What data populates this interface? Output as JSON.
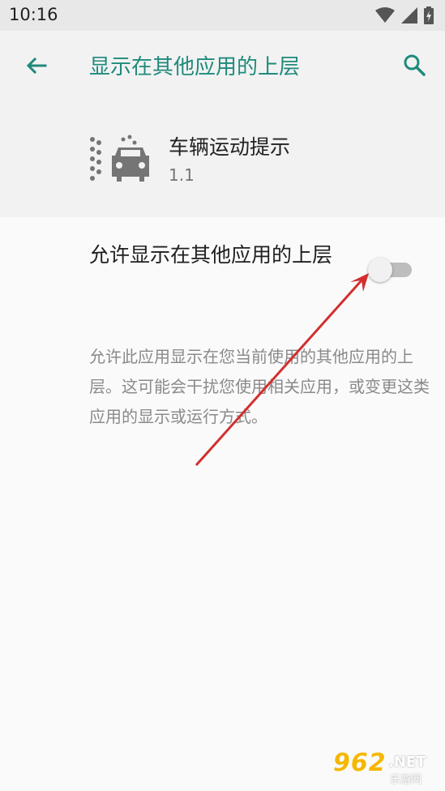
{
  "status_bar": {
    "time": "10:16"
  },
  "app_bar": {
    "title": "显示在其他应用的上层",
    "back_icon": "arrow-back-icon",
    "search_icon": "search-icon"
  },
  "app_header": {
    "name": "车辆运动提示",
    "version": "1.1",
    "icon": "car-motion-icon"
  },
  "permission": {
    "title": "允许显示在其他应用的上层",
    "enabled": false,
    "description": "允许此应用显示在您当前使用的其他应用的上层。这可能会干扰您使用相关应用，或变更这类应用的显示或运行方式。"
  },
  "watermark": {
    "number": "962",
    "net": ".NET",
    "sub": "乐游网"
  },
  "colors": {
    "accent": "#1f8a7c",
    "arrow": "#d32f2f",
    "background": "#fafafa"
  }
}
